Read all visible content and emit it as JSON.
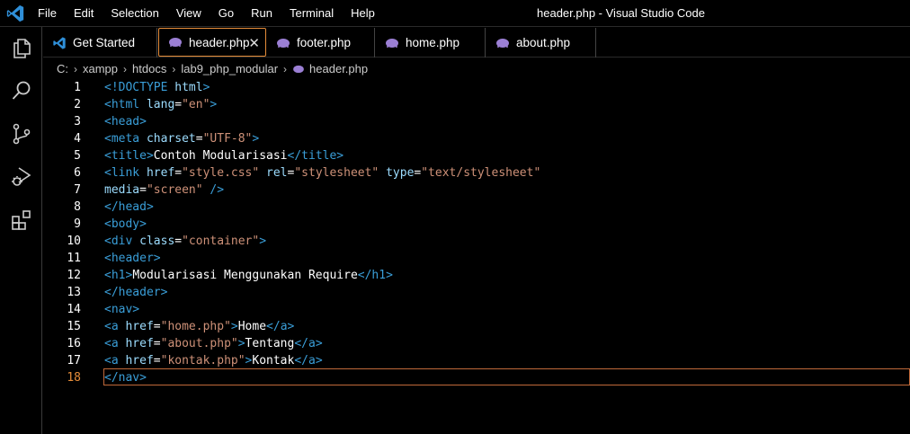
{
  "window": {
    "title": "header.php - Visual Studio Code"
  },
  "menu": [
    "File",
    "Edit",
    "Selection",
    "View",
    "Go",
    "Run",
    "Terminal",
    "Help"
  ],
  "activity": [
    "files-icon",
    "search-icon",
    "source-control-icon",
    "run-debug-icon",
    "extensions-icon"
  ],
  "tabs": [
    {
      "label": "Get Started",
      "icon": "vscode-icon"
    },
    {
      "label": "header.php",
      "icon": "php-icon",
      "active": true
    },
    {
      "label": "footer.php",
      "icon": "php-icon"
    },
    {
      "label": "home.php",
      "icon": "php-icon"
    },
    {
      "label": "about.php",
      "icon": "php-icon"
    }
  ],
  "breadcrumb": [
    "C:",
    "xampp",
    "htdocs",
    "lab9_php_modular",
    "header.php"
  ],
  "colors": {
    "accent": "#e58c39",
    "tag": "#3a9ed8",
    "attr": "#9cdcfe",
    "string": "#ce9178",
    "php": "#9b7fd4"
  },
  "editor": {
    "current_line": 18,
    "lines": [
      {
        "n": "1",
        "tokens": [
          [
            "tag",
            "<!DOCTYPE "
          ],
          [
            "attr",
            "html"
          ],
          [
            "tag",
            ">"
          ]
        ]
      },
      {
        "n": "2",
        "tokens": [
          [
            "tag",
            "<html "
          ],
          [
            "attr",
            "lang"
          ],
          [
            "txt",
            "="
          ],
          [
            "str",
            "\"en\""
          ],
          [
            "tag",
            ">"
          ]
        ]
      },
      {
        "n": "3",
        "tokens": [
          [
            "tag",
            "<head>"
          ]
        ]
      },
      {
        "n": "4",
        "tokens": [
          [
            "tag",
            "<meta "
          ],
          [
            "attr",
            "charset"
          ],
          [
            "txt",
            "="
          ],
          [
            "str",
            "\"UTF-8\""
          ],
          [
            "tag",
            ">"
          ]
        ]
      },
      {
        "n": "5",
        "tokens": [
          [
            "tag",
            "<title>"
          ],
          [
            "txt",
            "Contoh Modularisasi"
          ],
          [
            "tag",
            "</title>"
          ]
        ]
      },
      {
        "n": "6",
        "tokens": [
          [
            "tag",
            "<link "
          ],
          [
            "attr",
            "href"
          ],
          [
            "txt",
            "="
          ],
          [
            "str",
            "\"style.css\""
          ],
          [
            "txt",
            " "
          ],
          [
            "attr",
            "rel"
          ],
          [
            "txt",
            "="
          ],
          [
            "str",
            "\"stylesheet\""
          ],
          [
            "txt",
            " "
          ],
          [
            "attr",
            "type"
          ],
          [
            "txt",
            "="
          ],
          [
            "str",
            "\"text/stylesheet\""
          ]
        ]
      },
      {
        "n": "7",
        "tokens": [
          [
            "attr",
            "media"
          ],
          [
            "txt",
            "="
          ],
          [
            "str",
            "\"screen\""
          ],
          [
            "txt",
            " "
          ],
          [
            "tag",
            "/>"
          ]
        ]
      },
      {
        "n": "8",
        "tokens": [
          [
            "tag",
            "</head>"
          ]
        ]
      },
      {
        "n": "9",
        "tokens": [
          [
            "tag",
            "<body>"
          ]
        ]
      },
      {
        "n": "10",
        "tokens": [
          [
            "tag",
            "<div "
          ],
          [
            "attr",
            "class"
          ],
          [
            "txt",
            "="
          ],
          [
            "str",
            "\"container\""
          ],
          [
            "tag",
            ">"
          ]
        ]
      },
      {
        "n": "11",
        "tokens": [
          [
            "tag",
            "<header>"
          ]
        ]
      },
      {
        "n": "12",
        "tokens": [
          [
            "tag",
            "<h1>"
          ],
          [
            "txt",
            "Modularisasi Menggunakan Require"
          ],
          [
            "tag",
            "</h1>"
          ]
        ]
      },
      {
        "n": "13",
        "tokens": [
          [
            "tag",
            "</header>"
          ]
        ]
      },
      {
        "n": "14",
        "tokens": [
          [
            "tag",
            "<nav>"
          ]
        ]
      },
      {
        "n": "15",
        "tokens": [
          [
            "tag",
            "<a "
          ],
          [
            "attr",
            "href"
          ],
          [
            "txt",
            "="
          ],
          [
            "str",
            "\"home.php\""
          ],
          [
            "tag",
            ">"
          ],
          [
            "txt",
            "Home"
          ],
          [
            "tag",
            "</a>"
          ]
        ]
      },
      {
        "n": "16",
        "tokens": [
          [
            "tag",
            "<a "
          ],
          [
            "attr",
            "href"
          ],
          [
            "txt",
            "="
          ],
          [
            "str",
            "\"about.php\""
          ],
          [
            "tag",
            ">"
          ],
          [
            "txt",
            "Tentang"
          ],
          [
            "tag",
            "</a>"
          ]
        ]
      },
      {
        "n": "17",
        "tokens": [
          [
            "tag",
            "<a "
          ],
          [
            "attr",
            "href"
          ],
          [
            "txt",
            "="
          ],
          [
            "str",
            "\"kontak.php\""
          ],
          [
            "tag",
            ">"
          ],
          [
            "txt",
            "Kontak"
          ],
          [
            "tag",
            "</a>"
          ]
        ]
      },
      {
        "n": "18",
        "tokens": [
          [
            "tag",
            "</nav>"
          ]
        ]
      }
    ]
  }
}
